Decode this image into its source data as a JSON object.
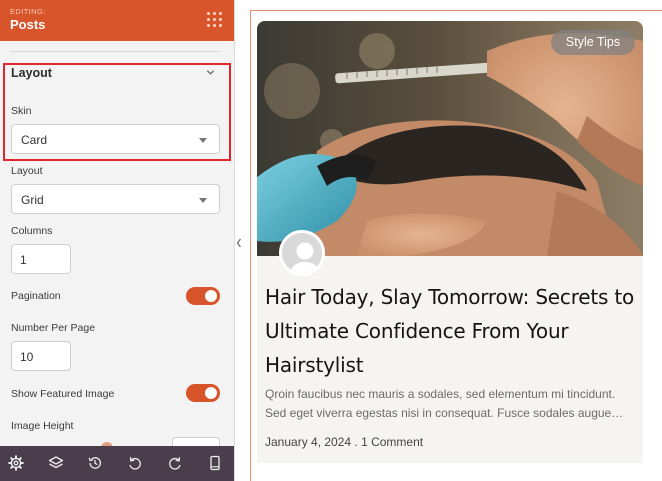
{
  "sidebar": {
    "editing_label": "EDITING:",
    "title": "Posts",
    "section": {
      "title": "Layout"
    },
    "skin": {
      "label": "Skin",
      "value": "Card"
    },
    "layout": {
      "label": "Layout",
      "value": "Grid"
    },
    "columns": {
      "label": "Columns",
      "value": "1"
    },
    "pagination": {
      "label": "Pagination",
      "on": true
    },
    "per_page": {
      "label": "Number Per Page",
      "value": "10"
    },
    "featured_image": {
      "label": "Show Featured Image",
      "on": true
    },
    "image_height": {
      "label": "Image Height"
    },
    "accent_color": "#d8542a",
    "toolbar_icons": [
      "gear-icon",
      "layers-icon",
      "history-icon",
      "undo-icon",
      "redo-icon",
      "mobile-preview-icon"
    ]
  },
  "preview": {
    "badge": "Style Tips",
    "post": {
      "title": "Hair Today, Slay Tomorrow: Secrets to Ultimate Confidence From Your Hairstylist",
      "excerpt": "Qroin faucibus nec mauris a sodales, sed elementum mi tincidunt. Sed eget viverra egestas nisi in consequat. Fusce sodales augue…",
      "date": "January 4, 2024",
      "separator": " . ",
      "comments": "1 Comment"
    }
  }
}
